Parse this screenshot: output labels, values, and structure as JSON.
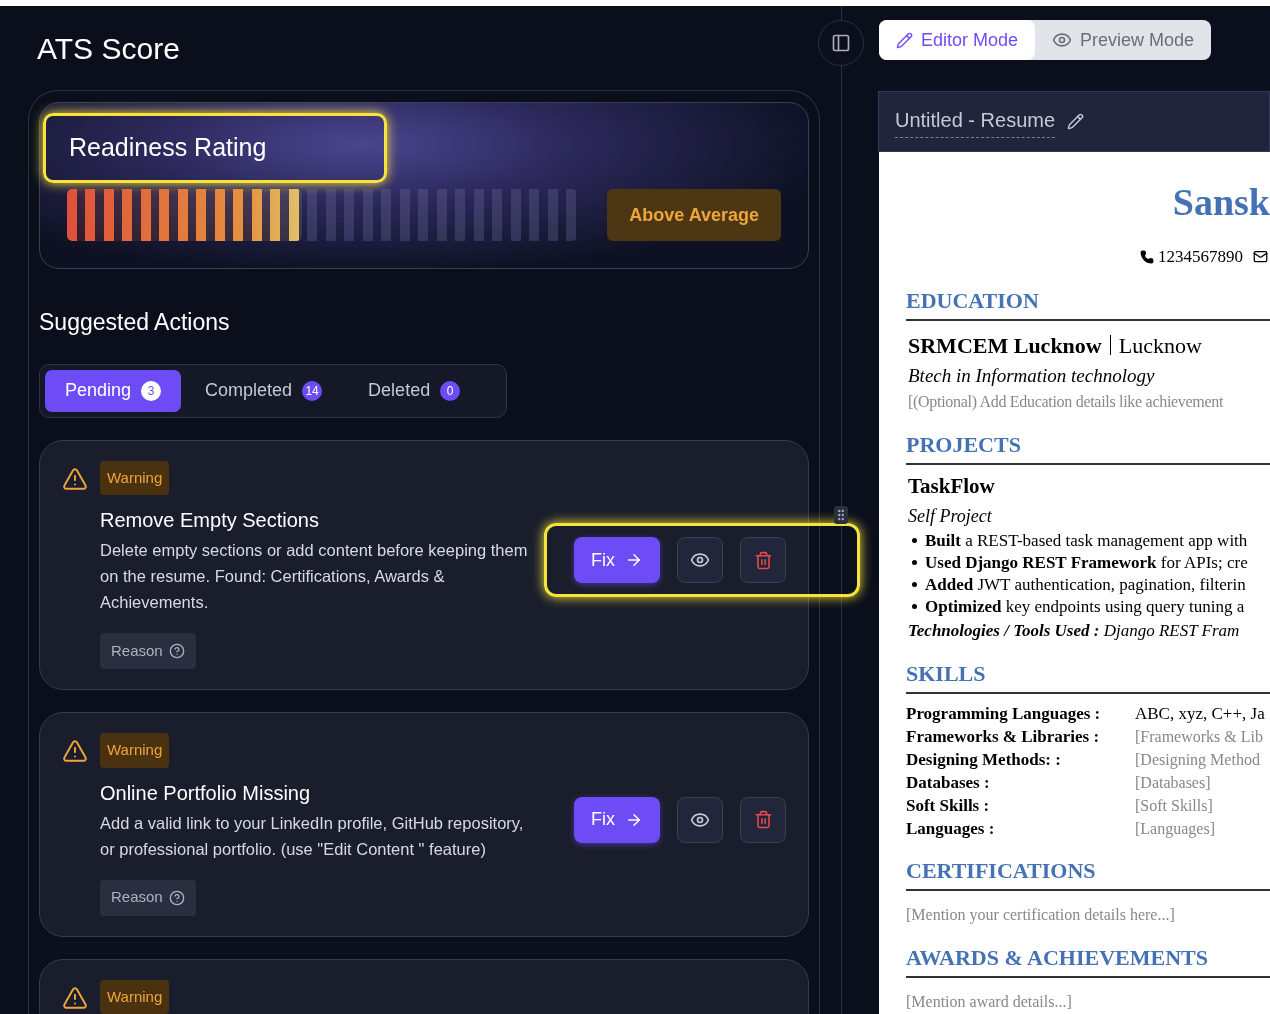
{
  "sidebar": {
    "title": "ATS Score"
  },
  "rating": {
    "title": "Readiness Rating",
    "highlighted": true,
    "level": 0.46,
    "verdict": "Above Average"
  },
  "suggested": {
    "title": "Suggested Actions",
    "tabs": [
      {
        "label": "Pending",
        "count": "3",
        "selected": true
      },
      {
        "label": "Completed",
        "count": "14",
        "selected": false
      },
      {
        "label": "Deleted",
        "count": "0",
        "selected": false
      }
    ],
    "cards": [
      {
        "badge": "Warning",
        "title": "Remove Empty Sections",
        "description": "Delete empty sections or add content before keeping them on the resume. Found: Certifications, Awards & Achievements.",
        "fix": "Fix",
        "reason": "Reason",
        "highlighted": true
      },
      {
        "badge": "Warning",
        "title": "Online Portfolio Missing",
        "description": "Add a valid link to your LinkedIn profile, GitHub repository, or professional portfolio. (use \"Edit Content \" feature)",
        "fix": "Fix",
        "reason": "Reason",
        "highlighted": false
      },
      {
        "badge": "Warning"
      }
    ]
  },
  "mode_toggle": [
    {
      "label": "Editor Mode",
      "kind": "editor",
      "selected": true
    },
    {
      "label": "Preview Mode",
      "kind": "preview",
      "selected": false
    }
  ],
  "document": {
    "title": "Untitled - Resume"
  },
  "resume": {
    "name": "Sansk",
    "phone": "1234567890",
    "education": {
      "title": "EDUCATION",
      "institution": "SRMCEM Lucknow",
      "location": "Lucknow",
      "degree": "Btech in Information technology",
      "note": "[(Optional) Add Education details like achievement"
    },
    "projects": {
      "title": "PROJECTS",
      "name": "TaskFlow",
      "type": "Self Project",
      "bullets": [
        "**Built** a REST-based task management app with",
        "**Used Django REST Framework** for APIs; cre",
        "**Added** JWT authentication, pagination, filterin",
        "**Optimized** key endpoints using query tuning a"
      ],
      "technologies": "**Technologies / Tools Used :** Django REST Fram"
    },
    "skills": {
      "title": "SKILLS",
      "rows": [
        {
          "label": "Programming Languages :",
          "value": "ABC, xyz, C++, Ja",
          "kind": "filled"
        },
        {
          "label": "Frameworks & Libraries :",
          "value": "[Frameworks & Lib",
          "kind": "empty"
        },
        {
          "label": "Designing Methods: :",
          "value": "[Designing Method",
          "kind": "empty"
        },
        {
          "label": "Databases :",
          "value": "[Databases]",
          "kind": "empty"
        },
        {
          "label": "Soft Skills :",
          "value": "[Soft Skills]",
          "kind": "empty"
        },
        {
          "label": "Languages :",
          "value": "[Languages]",
          "kind": "empty"
        }
      ]
    },
    "certifications": {
      "title": "CERTIFICATIONS",
      "note": "[Mention your certification details here...]"
    },
    "awards": {
      "title": "AWARDS & ACHIEVEMENTS",
      "note": "[Mention award details...]"
    }
  }
}
